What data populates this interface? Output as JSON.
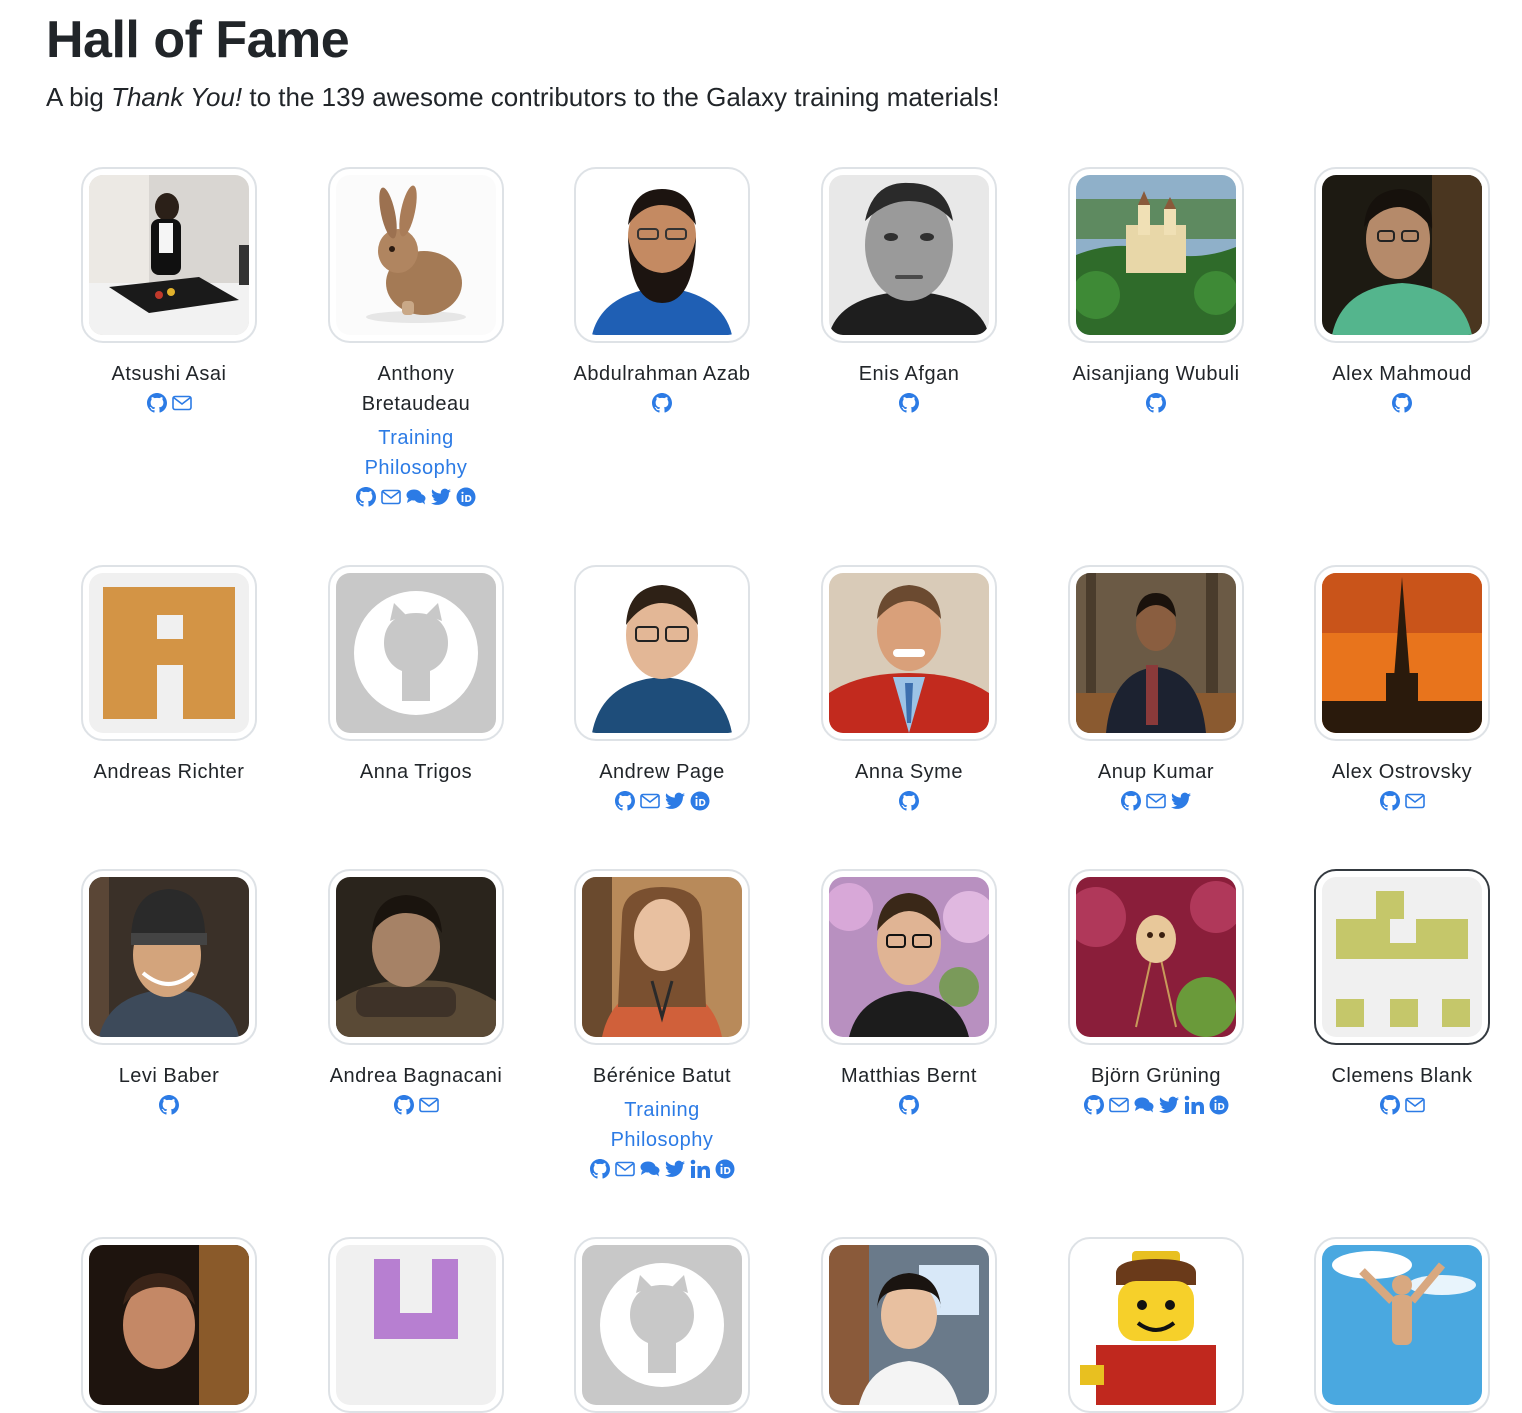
{
  "page": {
    "title": "Hall of Fame",
    "intro_prefix": "A big ",
    "intro_emph": "Thank You!",
    "intro_middle": " to the ",
    "intro_count": "139",
    "intro_suffix": " awesome contributors to the Galaxy training materials!"
  },
  "colors": {
    "link": "#2c7be5",
    "text": "#212529",
    "frame": "#dee2e6"
  },
  "contributors": [
    {
      "name": "Atsushi Asai",
      "joined": "",
      "links": [
        "github-icon",
        "email-icon"
      ],
      "avatar": "photo-person-desk"
    },
    {
      "name": "Anthony Bretaudeau",
      "joined": "Training Philosophy",
      "links": [
        "github-icon",
        "email-icon",
        "chat-icon",
        "twitter-icon",
        "orcid-icon"
      ],
      "avatar": "photo-rabbit"
    },
    {
      "name": "Abdulrahman Azab",
      "joined": "",
      "links": [
        "github-icon"
      ],
      "avatar": "photo-bearded-man"
    },
    {
      "name": "Enis Afgan",
      "joined": "",
      "links": [
        "github-icon"
      ],
      "avatar": "photo-bw-portrait"
    },
    {
      "name": "Aisanjiang Wubuli",
      "joined": "",
      "links": [
        "github-icon"
      ],
      "avatar": "photo-castle"
    },
    {
      "name": "Alex Mahmoud",
      "joined": "",
      "links": [
        "github-icon"
      ],
      "avatar": "photo-green-shirt"
    },
    {
      "name": "Andreas Richter",
      "joined": "",
      "links": [],
      "avatar": "identicon-orange"
    },
    {
      "name": "Anna Trigos",
      "joined": "",
      "links": [],
      "avatar": "github-default"
    },
    {
      "name": "Andrew Page",
      "joined": "",
      "links": [
        "github-icon",
        "email-icon",
        "twitter-icon",
        "orcid-icon"
      ],
      "avatar": "photo-glasses-man"
    },
    {
      "name": "Anna Syme",
      "joined": "",
      "links": [
        "github-icon"
      ],
      "avatar": "photo-red-jacket"
    },
    {
      "name": "Anup Kumar",
      "joined": "",
      "links": [
        "github-icon",
        "email-icon",
        "twitter-icon"
      ],
      "avatar": "photo-forest-man"
    },
    {
      "name": "Alex Ostrovsky",
      "joined": "",
      "links": [
        "github-icon",
        "email-icon"
      ],
      "avatar": "photo-sunset-spire"
    },
    {
      "name": "Levi Baber",
      "joined": "",
      "links": [
        "github-icon"
      ],
      "avatar": "photo-beanie"
    },
    {
      "name": "Andrea Bagnacani",
      "joined": "",
      "links": [
        "github-icon",
        "email-icon"
      ],
      "avatar": "photo-dark-portrait"
    },
    {
      "name": "Bérénice Batut",
      "joined": "Training Philosophy",
      "links": [
        "github-icon",
        "email-icon",
        "chat-icon",
        "twitter-icon",
        "linkedin-icon",
        "orcid-icon"
      ],
      "avatar": "photo-woman"
    },
    {
      "name": "Matthias Bernt",
      "joined": "",
      "links": [
        "github-icon"
      ],
      "avatar": "photo-blossom-man"
    },
    {
      "name": "Björn Grüning",
      "joined": "",
      "links": [
        "github-icon",
        "email-icon",
        "chat-icon",
        "twitter-icon",
        "linkedin-icon",
        "orcid-icon"
      ],
      "avatar": "photo-orchid"
    },
    {
      "name": "Clemens Blank",
      "joined": "",
      "links": [
        "github-icon",
        "email-icon"
      ],
      "avatar": "identicon-olive"
    },
    {
      "name": "",
      "joined": "",
      "links": [],
      "avatar": "photo-stage-man"
    },
    {
      "name": "",
      "joined": "",
      "links": [],
      "avatar": "identicon-purple"
    },
    {
      "name": "",
      "joined": "",
      "links": [],
      "avatar": "github-default"
    },
    {
      "name": "",
      "joined": "",
      "links": [],
      "avatar": "photo-office-woman"
    },
    {
      "name": "",
      "joined": "",
      "links": [],
      "avatar": "photo-lego"
    },
    {
      "name": "",
      "joined": "",
      "links": [],
      "avatar": "photo-sky-jump"
    }
  ]
}
